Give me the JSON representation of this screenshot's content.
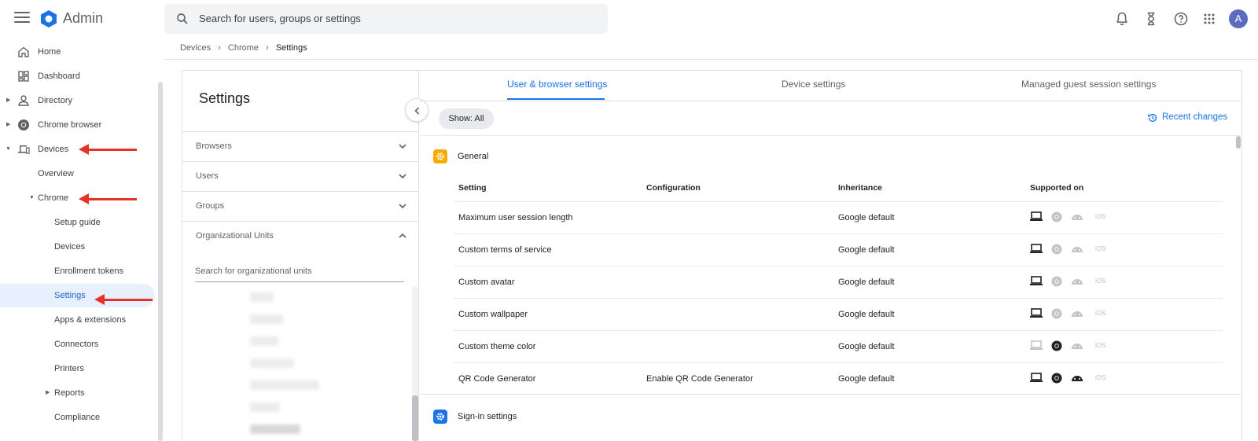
{
  "header": {
    "app_title": "Admin",
    "search_placeholder": "Search for users, groups or settings",
    "avatar_letter": "A"
  },
  "nav": {
    "home": "Home",
    "dashboard": "Dashboard",
    "directory": "Directory",
    "chrome_browser": "Chrome browser",
    "devices": "Devices",
    "overview": "Overview",
    "chrome": "Chrome",
    "setup_guide": "Setup guide",
    "devices_sub": "Devices",
    "enrollment_tokens": "Enrollment tokens",
    "settings": "Settings",
    "apps_extensions": "Apps & extensions",
    "connectors": "Connectors",
    "printers": "Printers",
    "reports": "Reports",
    "compliance": "Compliance"
  },
  "breadcrumb": [
    "Devices",
    "Chrome",
    "Settings"
  ],
  "settings_panel": {
    "title": "Settings",
    "accordions": [
      "Browsers",
      "Users",
      "Groups",
      "Organizational Units"
    ],
    "ou_search_placeholder": "Search for organizational units"
  },
  "tabs": [
    "User & browser settings",
    "Device settings",
    "Managed guest session settings"
  ],
  "filter_chip": "Show: All",
  "recent_changes": "Recent changes",
  "sections": [
    {
      "title": "General",
      "color": "#f9ab00"
    },
    {
      "title": "Sign-in settings",
      "color": "#1a73e8"
    }
  ],
  "table": {
    "headers": [
      "Setting",
      "Configuration",
      "Inheritance",
      "Supported on"
    ],
    "rows": [
      {
        "setting": "Maximum user session length",
        "configuration": "",
        "inheritance": "Google default"
      },
      {
        "setting": "Custom terms of service",
        "configuration": "",
        "inheritance": "Google default"
      },
      {
        "setting": "Custom avatar",
        "configuration": "",
        "inheritance": "Google default"
      },
      {
        "setting": "Custom wallpaper",
        "configuration": "",
        "inheritance": "Google default"
      },
      {
        "setting": "Custom theme color",
        "configuration": "",
        "inheritance": "Google default"
      },
      {
        "setting": "QR Code Generator",
        "configuration": "Enable QR Code Generator",
        "inheritance": "Google default"
      }
    ]
  },
  "supported_label": "iOS",
  "colors": {
    "accent": "#1a73e8",
    "arrow": "#e53229",
    "active_bg": "#e8f0fe"
  }
}
